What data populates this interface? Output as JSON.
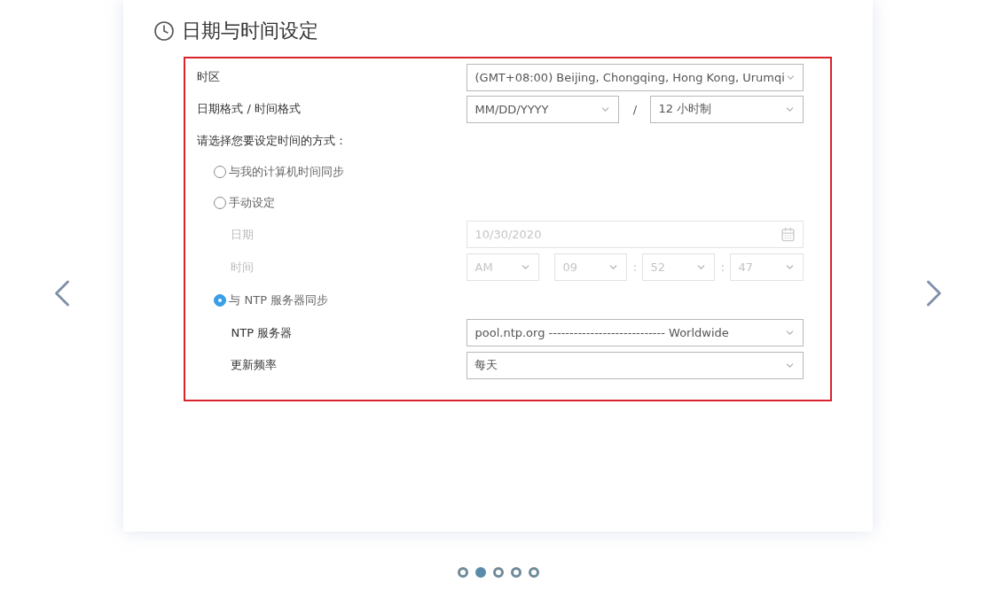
{
  "title": "日期与时间设定",
  "timezone": {
    "label": "时区",
    "value": "(GMT+08:00) Beijing, Chongqing, Hong Kong, Urumqi"
  },
  "format": {
    "label": "日期格式 / 时间格式",
    "date_format": "MM/DD/YYYY",
    "separator": "/",
    "time_format": "12 小时制"
  },
  "method_prompt": "请选择您要设定时间的方式：",
  "methods": [
    {
      "label": "与我的计算机时间同步",
      "selected": false
    },
    {
      "label": "手动设定",
      "selected": false
    },
    {
      "label": "与 NTP 服务器同步",
      "selected": true
    }
  ],
  "manual": {
    "disabled": true,
    "date_label": "日期",
    "date_value": "10/30/2020",
    "time_label": "时间",
    "ampm": "AM",
    "hour": "09",
    "minute": "52",
    "second": "47",
    "separators": [
      ":",
      ":"
    ]
  },
  "ntp_server": {
    "label": "NTP 服务器",
    "value": "pool.ntp.org ---------------------------- Worldwide"
  },
  "frequency": {
    "label": "更新频率",
    "value": "每天"
  },
  "pager": [
    {
      "selected": false
    },
    {
      "selected": true
    },
    {
      "selected": false
    },
    {
      "selected": false
    },
    {
      "selected": false
    }
  ]
}
